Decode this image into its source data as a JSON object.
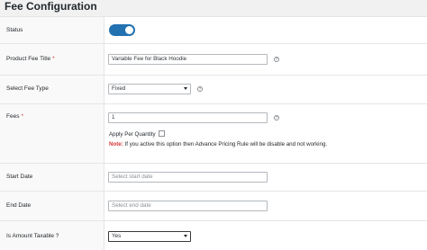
{
  "header": {
    "title": "Fee Configuration"
  },
  "rows": {
    "status": {
      "label": "Status",
      "enabled": true
    },
    "title": {
      "label": "Product Fee Title",
      "required_mark": "*",
      "value": "Variable Fee for Black Hoodie",
      "help_icon": "question-circle-icon"
    },
    "fee_type": {
      "label": "Select Fee Type",
      "value": "Fixed",
      "help_icon": "question-circle-icon"
    },
    "fees": {
      "label": "Fees",
      "required_mark": "*",
      "value": "1",
      "help_icon": "question-circle-icon",
      "apply_per_quantity_label": "Apply Per Quantity",
      "apply_per_quantity_checked": false,
      "note_label": "Note:",
      "note_text": "If you active this option then Advance Pricing Rule will be disable and not working."
    },
    "start_date": {
      "label": "Start Date",
      "placeholder": "Select start date"
    },
    "end_date": {
      "label": "End Date",
      "placeholder": "Select end date"
    },
    "taxable": {
      "label": "Is Amount Taxable ?",
      "value": "Yes"
    }
  },
  "colors": {
    "accent": "#2271b1",
    "required": "#d63638"
  }
}
